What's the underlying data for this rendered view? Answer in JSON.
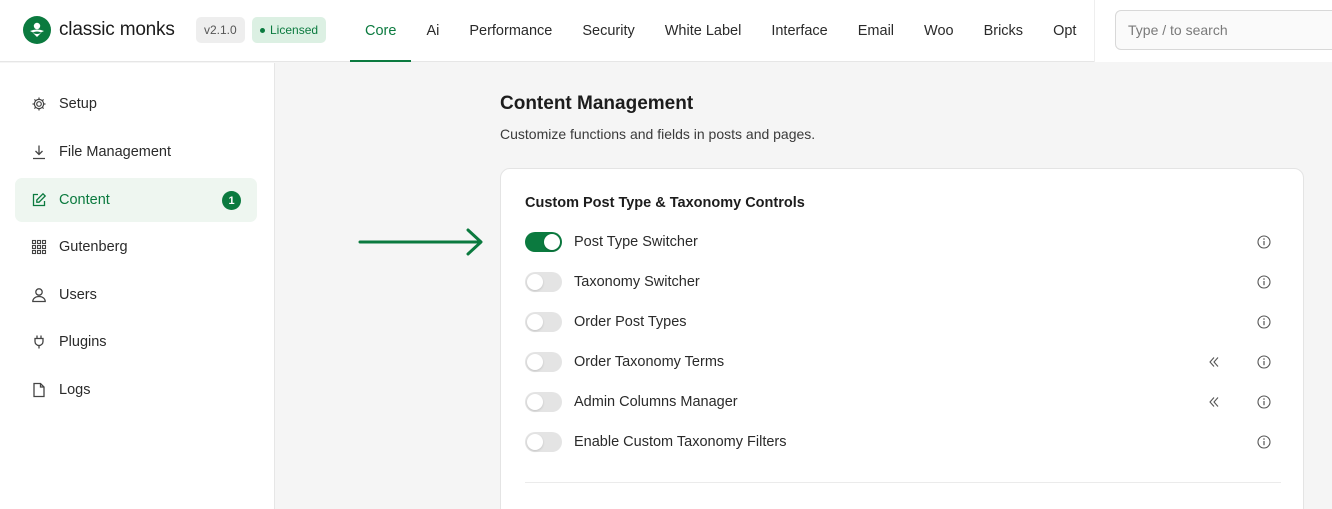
{
  "brand": {
    "name": "classic monks",
    "version": "v2.1.0",
    "license": "Licensed",
    "accent": "#0b7a3f"
  },
  "nav": {
    "tabs": [
      {
        "label": "Core",
        "active": true
      },
      {
        "label": "Ai"
      },
      {
        "label": "Performance"
      },
      {
        "label": "Security"
      },
      {
        "label": "White Label"
      },
      {
        "label": "Interface"
      },
      {
        "label": "Email"
      },
      {
        "label": "Woo"
      },
      {
        "label": "Bricks"
      },
      {
        "label": "Opt"
      }
    ]
  },
  "search": {
    "placeholder": "Type / to search",
    "value": ""
  },
  "sidebar": {
    "items": [
      {
        "label": "Setup",
        "icon": "gear-icon"
      },
      {
        "label": "File Management",
        "icon": "download-icon"
      },
      {
        "label": "Content",
        "icon": "edit-icon",
        "active": true,
        "badge": "1"
      },
      {
        "label": "Gutenberg",
        "icon": "grid-icon"
      },
      {
        "label": "Users",
        "icon": "user-icon"
      },
      {
        "label": "Plugins",
        "icon": "plug-icon"
      },
      {
        "label": "Logs",
        "icon": "file-icon"
      }
    ]
  },
  "main": {
    "title": "Content Management",
    "subtitle": "Customize functions and fields in posts and pages.",
    "card": {
      "title": "Custom Post Type & Taxonomy Controls",
      "rows": [
        {
          "label": "Post Type Switcher",
          "enabled": true,
          "has_chevron": false
        },
        {
          "label": "Taxonomy Switcher",
          "enabled": false,
          "has_chevron": false
        },
        {
          "label": "Order Post Types",
          "enabled": false,
          "has_chevron": false
        },
        {
          "label": "Order Taxonomy Terms",
          "enabled": false,
          "has_chevron": true
        },
        {
          "label": "Admin Columns Manager",
          "enabled": false,
          "has_chevron": true
        },
        {
          "label": "Enable Custom Taxonomy Filters",
          "enabled": false,
          "has_chevron": false
        }
      ]
    }
  }
}
